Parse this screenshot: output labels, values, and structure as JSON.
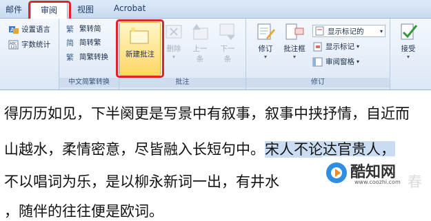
{
  "tabs": [
    {
      "label": "邮件"
    },
    {
      "label": "审阅"
    },
    {
      "label": "视图"
    },
    {
      "label": "Acrobat"
    }
  ],
  "proofing": {
    "items": [
      {
        "label": "设置语言",
        "icon": "language-icon"
      },
      {
        "label": "字数统计",
        "icon": "word-count-icon"
      }
    ]
  },
  "chinese_conversion": {
    "items": [
      {
        "label": "繁转简",
        "icon": "trad-to-simp-icon"
      },
      {
        "label": "简转繁",
        "icon": "simp-to-trad-icon"
      },
      {
        "label": "简繁转换",
        "icon": "conversion-icon"
      }
    ],
    "group_label": "中文简繁转换"
  },
  "comments": {
    "new_comment": "新建批注",
    "delete": "删除",
    "previous_1": "上一",
    "previous_2": "条",
    "next_1": "下一",
    "next_2": "条",
    "group_label": "批注"
  },
  "tracking": {
    "track_changes": "修订",
    "balloons": "批注框",
    "display_dropdown": "显示标记的",
    "show_markup": "显示标记",
    "reviewing_pane": "审阅窗格",
    "group_label": "修订"
  },
  "changes": {
    "accept": "接受"
  },
  "document": {
    "lines": [
      "得历历如见，下半阕更是写景中有叙事，叙事中挟抒情，自近而",
      "山越水，柔情密意，尽皆融入长短句中。",
      "不以唱词为乐，是以柳永新词一出，有井水",
      "，随伴的往往便是欧词。"
    ],
    "highlight": "宋人不论达官贵人，",
    "trailing_3": "春"
  },
  "watermark": {
    "name": "酷知网",
    "url": "www.coozhi.com"
  },
  "colors": {
    "accent": "#e0222a",
    "highlight": "#c9dcf2",
    "selected_button": "#ffd764"
  }
}
